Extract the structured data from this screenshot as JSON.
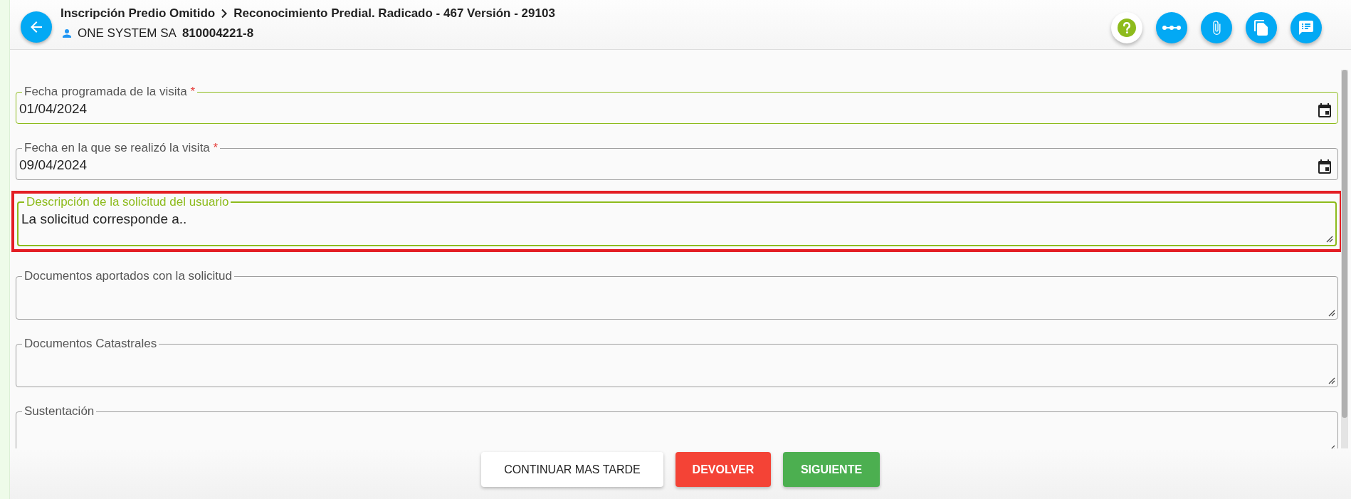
{
  "header": {
    "breadcrumb": [
      "Inscripción Predio Omitido",
      "Reconocimiento Predial. Radicado - 467 Versión - 29103"
    ],
    "owner_name": "ONE SYSTEM SA",
    "owner_id": "810004221-8"
  },
  "fields": [
    {
      "kind": "date",
      "label": "Fecha programada de la visita",
      "required_mark": "*",
      "value": "01/04/2024",
      "valid": true,
      "focused": false,
      "highlighted": false
    },
    {
      "kind": "date",
      "label": "Fecha en la que se realizó la visita",
      "required_mark": "*",
      "value": "09/04/2024",
      "valid": false,
      "focused": false,
      "highlighted": false
    },
    {
      "kind": "textarea",
      "label": "Descripción de la solicitud del usuario",
      "value": "La solicitud corresponde a..",
      "valid": true,
      "focused": true,
      "highlighted": true
    },
    {
      "kind": "textarea",
      "label": "Documentos aportados con la solicitud",
      "valid": false,
      "focused": false,
      "highlighted": false
    },
    {
      "kind": "textarea",
      "label": "Documentos Catastrales",
      "valid": false,
      "focused": false,
      "highlighted": false
    },
    {
      "kind": "textarea",
      "label": "Sustentación",
      "valid": false,
      "focused": false,
      "highlighted": false
    }
  ],
  "buttons": [
    {
      "kind": "plain",
      "label": "CONTINUAR MAS TARDE"
    },
    {
      "kind": "danger",
      "label": "DEVOLVER"
    },
    {
      "kind": "success",
      "label": "SIGUIENTE"
    }
  ]
}
